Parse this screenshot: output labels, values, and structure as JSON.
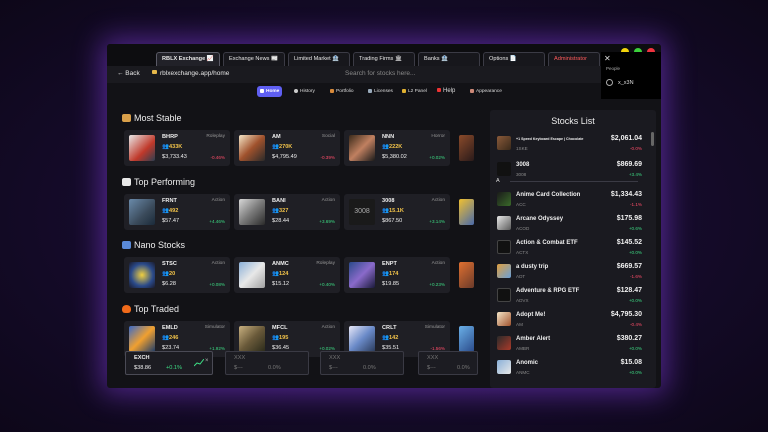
{
  "tabs": [
    {
      "label": "RBLX Exchange 📈"
    },
    {
      "label": "Exchange News 📰"
    },
    {
      "label": "Limited Market 🏦"
    },
    {
      "label": "Trading Firms 🏛"
    },
    {
      "label": "Banks 🏦"
    },
    {
      "label": "Options 📄"
    },
    {
      "label": "Administrator"
    }
  ],
  "address": {
    "back": "← Back",
    "url": "rblxexchange.app/home",
    "search_placeholder": "Search for stocks here..."
  },
  "people": {
    "title": "People",
    "user": "x_x3N",
    "close": "✕"
  },
  "nav": [
    {
      "label": "Home"
    },
    {
      "label": "History"
    },
    {
      "label": "Portfolio"
    },
    {
      "label": "Licenses"
    },
    {
      "label": "L2 Panel"
    },
    {
      "label": "Help"
    },
    {
      "label": "Appearance"
    }
  ],
  "sections": [
    {
      "title": "Most Stable",
      "cards": [
        {
          "ticker": "BHRP",
          "genre": "Roleplay",
          "volume": "433K",
          "price": "$3,733.43",
          "change": "-0.46%",
          "dir": "neg"
        },
        {
          "ticker": "AM",
          "genre": "Social",
          "volume": "270K",
          "price": "$4,795.49",
          "change": "-0.39%",
          "dir": "neg"
        },
        {
          "ticker": "NNN",
          "genre": "Horror",
          "volume": "222K",
          "price": "$5,380.02",
          "change": "+0.02%",
          "dir": "pos"
        }
      ]
    },
    {
      "title": "Top Performing",
      "cards": [
        {
          "ticker": "FRNT",
          "genre": "Action",
          "volume": "492",
          "price": "$57.47",
          "change": "+4.46%",
          "dir": "pos"
        },
        {
          "ticker": "BANI",
          "genre": "Action",
          "volume": "327",
          "price": "$28.44",
          "change": "+3.69%",
          "dir": "pos"
        },
        {
          "ticker": "3008",
          "genre": "Action",
          "volume": "15.1K",
          "price": "$867.50",
          "change": "+3.14%",
          "dir": "pos"
        }
      ]
    },
    {
      "title": "Nano Stocks",
      "cards": [
        {
          "ticker": "STSC",
          "genre": "Action",
          "volume": "20",
          "price": "$6.28",
          "change": "+0.08%",
          "dir": "pos"
        },
        {
          "ticker": "ANMC",
          "genre": "Roleplay",
          "volume": "124",
          "price": "$15.12",
          "change": "+0.40%",
          "dir": "pos"
        },
        {
          "ticker": "ENPT",
          "genre": "Action",
          "volume": "174",
          "price": "$19.85",
          "change": "+0.23%",
          "dir": "pos"
        }
      ]
    },
    {
      "title": "Top Traded",
      "cards": [
        {
          "ticker": "EMLD",
          "genre": "Simulator",
          "volume": "246",
          "price": "$23.74",
          "change": "+1.92%",
          "dir": "pos"
        },
        {
          "ticker": "MFCL",
          "genre": "Action",
          "volume": "195",
          "price": "$36.45",
          "change": "+0.02%",
          "dir": "pos"
        },
        {
          "ticker": "CRLT",
          "genre": "Simulator",
          "volume": "142",
          "price": "$35.51",
          "change": "-1.56%",
          "dir": "neg"
        }
      ]
    }
  ],
  "tickers": [
    {
      "symbol": "EXCH",
      "price": "$38.86",
      "change": "+0.1%",
      "dir": "pos"
    },
    {
      "symbol": "XXX",
      "price": "$---",
      "change": "0.0%",
      "dir": "ph"
    },
    {
      "symbol": "XXX",
      "price": "$---",
      "change": "0.0%",
      "dir": "ph"
    },
    {
      "symbol": "XXX",
      "price": "$---",
      "change": "0.0%",
      "dir": "ph"
    }
  ],
  "stocks_list": {
    "title": "Stocks List",
    "letter": "A",
    "top": [
      {
        "name": "+1 Speed Keyboard Escape | Chocolate",
        "code": "1SKE",
        "price": "$2,061.04",
        "change": "-0.0%",
        "dir": "neg",
        "small": true
      },
      {
        "name": "3008",
        "code": "3008",
        "price": "$869.69",
        "change": "+3.4%",
        "dir": "pos"
      }
    ],
    "items": [
      {
        "name": "Anime Card Collection",
        "code": "ACC",
        "price": "$1,334.43",
        "change": "-1.1%",
        "dir": "neg"
      },
      {
        "name": "Arcane Odyssey",
        "code": "ACOD",
        "price": "$175.98",
        "change": "+0.6%",
        "dir": "pos"
      },
      {
        "name": "Action & Combat ETF",
        "code": "ACTX",
        "price": "$145.52",
        "change": "+0.0%",
        "dir": "pos"
      },
      {
        "name": "a dusty trip",
        "code": "ADT",
        "price": "$669.57",
        "change": "-1.6%",
        "dir": "neg"
      },
      {
        "name": "Adventure & RPG ETF",
        "code": "ADVX",
        "price": "$128.47",
        "change": "+0.0%",
        "dir": "pos"
      },
      {
        "name": "Adopt Me!",
        "code": "AM",
        "price": "$4,795.30",
        "change": "-0.4%",
        "dir": "neg"
      },
      {
        "name": "Amber Alert",
        "code": "AMBR",
        "price": "$380.27",
        "change": "+0.0%",
        "dir": "pos"
      },
      {
        "name": "Anomic",
        "code": "ANMC",
        "price": "$15.08",
        "change": "+0.0%",
        "dir": "pos"
      }
    ]
  },
  "colors": {
    "accent": "#5f5ff2",
    "positive": "#3ddc84",
    "negative": "#ff4d6a",
    "volume": "#f3c44a",
    "glow": "#9646ff"
  }
}
